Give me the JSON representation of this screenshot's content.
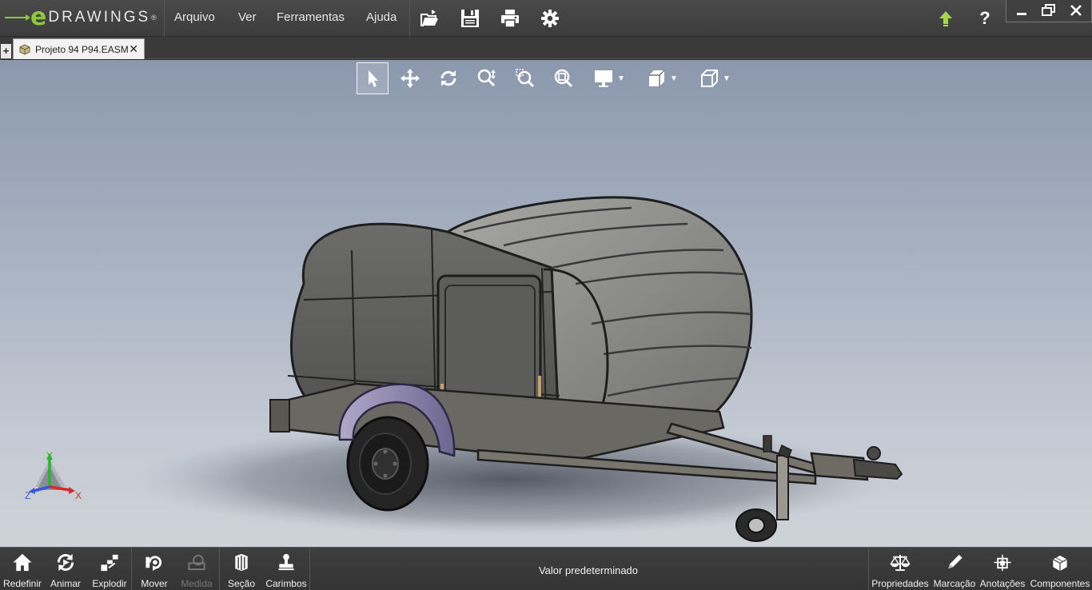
{
  "app": {
    "logo_letter": "e",
    "logo_word": "DRAWINGS",
    "logo_mark": "®"
  },
  "menu": {
    "items": [
      "Arquivo",
      "Ver",
      "Ferramentas",
      "Ajuda"
    ]
  },
  "toolbar": {
    "icons": [
      "open-folder-icon",
      "save-icon",
      "print-icon",
      "settings-gear-icon"
    ],
    "right_icons": [
      "update-arrow-icon",
      "help-icon"
    ]
  },
  "window": {
    "minimize": "minimize-icon",
    "maximize": "restore-icon",
    "close": "close-icon"
  },
  "tabs": {
    "add_label": "+",
    "document": "Projeto 94 P94.EASM",
    "close_label": "✕"
  },
  "view_toolbar": {
    "tools": [
      "select-arrow-icon",
      "pan-icon",
      "rotate-icon",
      "zoom-icon",
      "zoom-to-area-icon",
      "zoom-to-fit-icon",
      "display-style-icon",
      "shaded-view-icon",
      "standard-views-icon"
    ]
  },
  "triad": {
    "x": "X",
    "y": "Y",
    "z": "Z",
    "colors": {
      "x": "#d22b2b",
      "y": "#2bb52b",
      "z": "#3a57d6"
    }
  },
  "bottom": {
    "left_tools": [
      {
        "label": "Redefinir",
        "icon": "home-icon"
      },
      {
        "label": "Animar",
        "icon": "animate-icon"
      },
      {
        "label": "Explodir",
        "icon": "explode-icon"
      },
      {
        "label": "Mover",
        "icon": "move-icon"
      },
      {
        "label": "Medida",
        "icon": "measure-icon",
        "disabled": true
      },
      {
        "label": "Seção",
        "icon": "section-icon"
      },
      {
        "label": "Carimbos",
        "icon": "stamp-icon"
      }
    ],
    "status": "Valor predeterminado",
    "right_tools": [
      {
        "label": "Propriedades",
        "icon": "scales-icon"
      },
      {
        "label": "Marcação",
        "icon": "pencil-icon"
      },
      {
        "label": "Anotações",
        "icon": "annotation-icon"
      },
      {
        "label": "Componentes",
        "icon": "components-icon"
      }
    ]
  },
  "colors": {
    "logo_green": "#8ec63f",
    "chrome_dark": "#3c3c3c",
    "viewport_top": "#8b98ad",
    "viewport_bottom": "#cfd3d9"
  }
}
